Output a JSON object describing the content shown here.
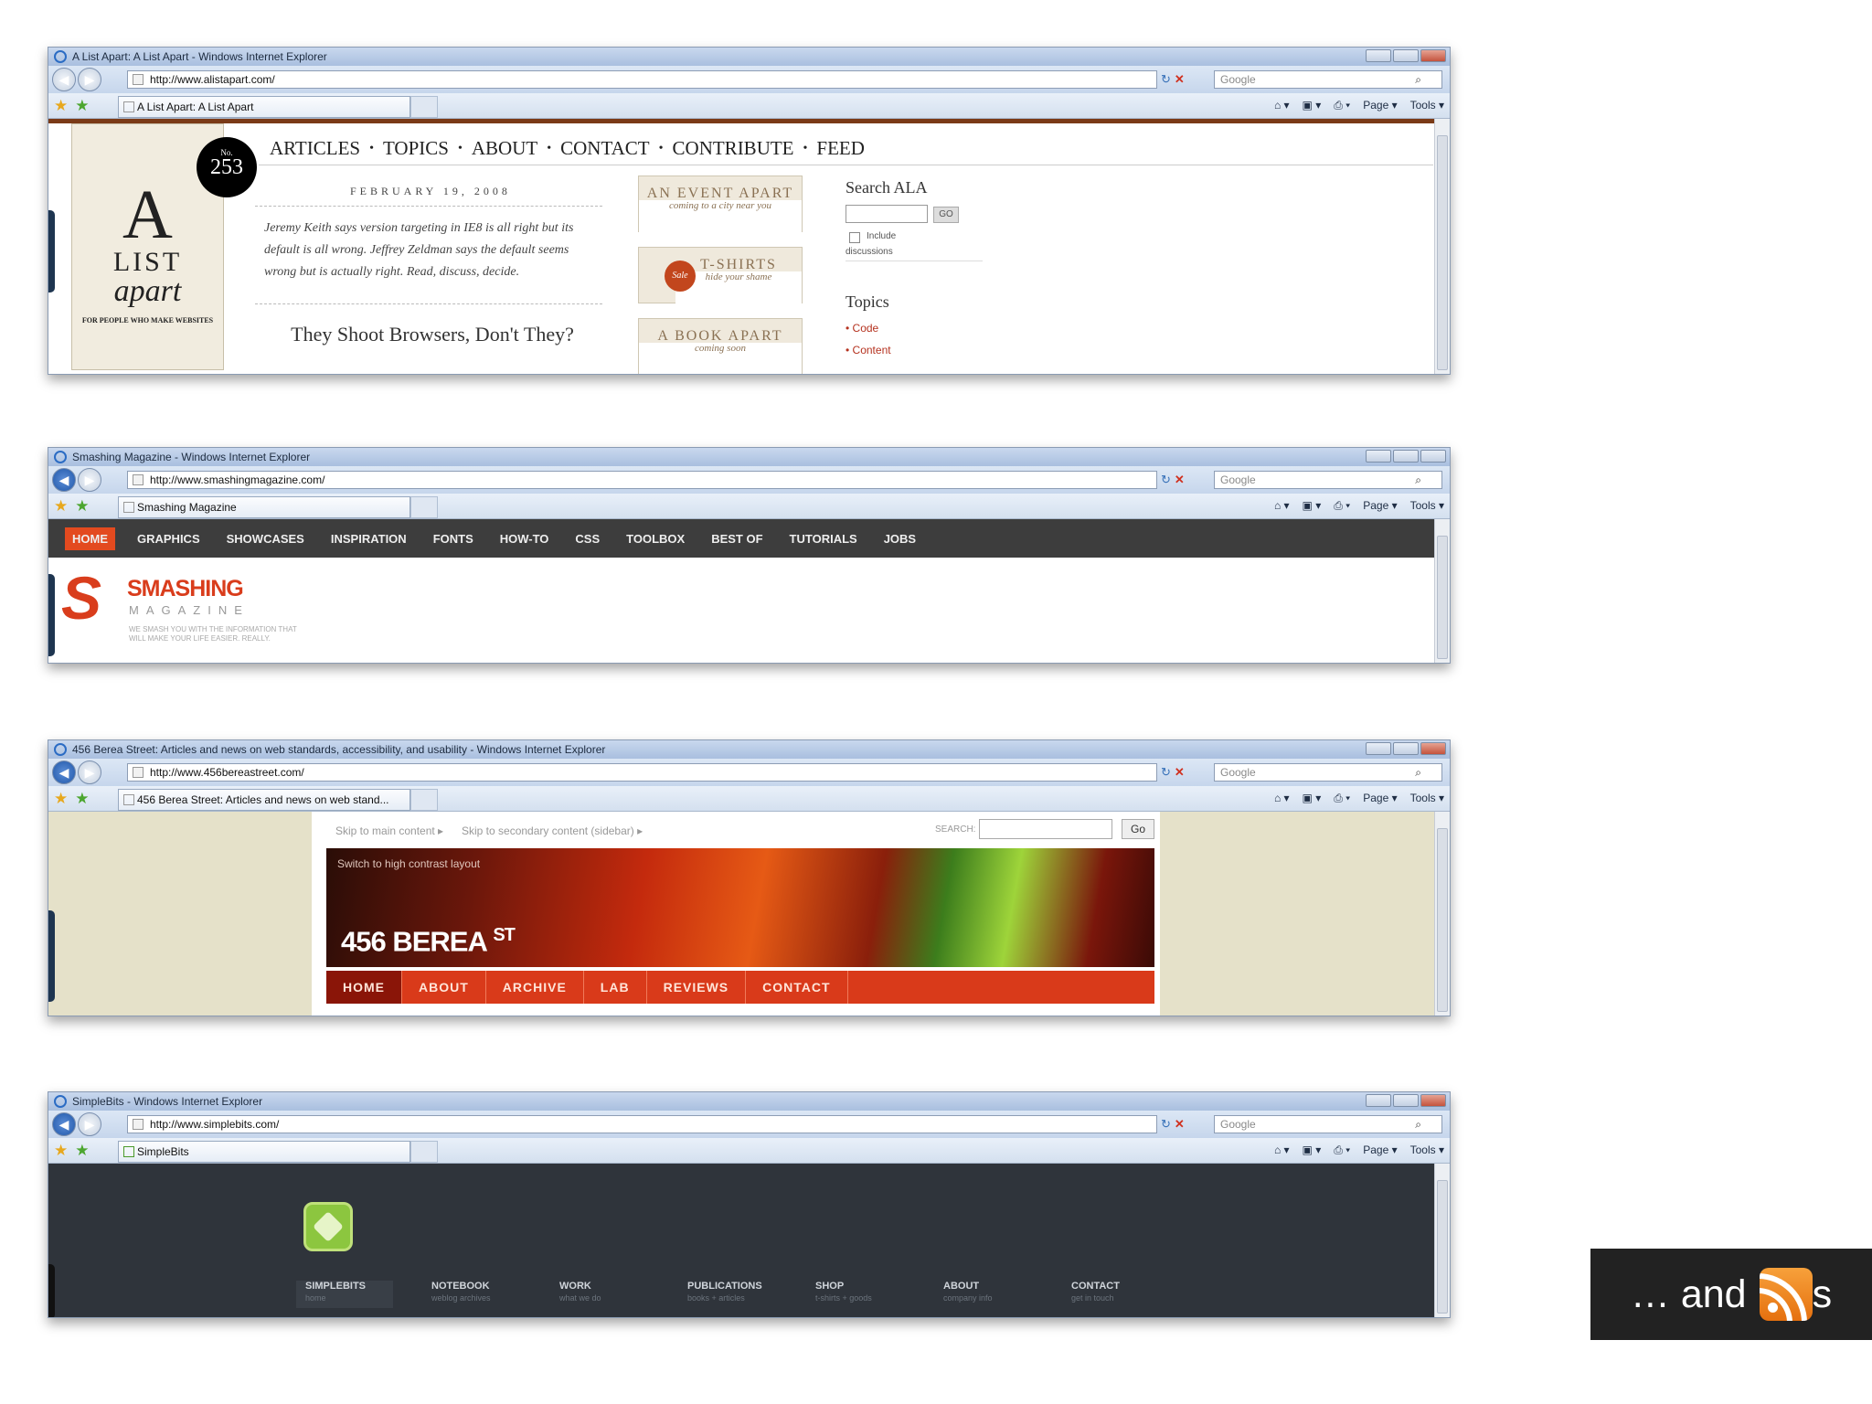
{
  "windows": [
    {
      "title": "A List Apart: A List Apart - Windows Internet Explorer",
      "url": "http://www.alistapart.com/",
      "search_placeholder": "Google",
      "tab": "A List Apart: A List Apart",
      "commands": [
        "Page ▾",
        "Tools ▾"
      ]
    },
    {
      "title": "Smashing Magazine - Windows Internet Explorer",
      "url": "http://www.smashingmagazine.com/",
      "search_placeholder": "Google",
      "tab": "Smashing Magazine",
      "commands": [
        "Page ▾",
        "Tools ▾"
      ]
    },
    {
      "title": "456 Berea Street: Articles and news on web standards, accessibility, and usability - Windows Internet Explorer",
      "url": "http://www.456bereastreet.com/",
      "search_placeholder": "Google",
      "tab": "456 Berea Street: Articles and news on web stand...",
      "commands": [
        "Page ▾",
        "Tools ▾"
      ]
    },
    {
      "title": "SimpleBits - Windows Internet Explorer",
      "url": "http://www.simplebits.com/",
      "search_placeholder": "Google",
      "tab": "SimpleBits",
      "commands": [
        "Page ▾",
        "Tools ▾"
      ]
    }
  ],
  "ala": {
    "issue_label": "No.",
    "issue_number": "253",
    "logo_a": "A",
    "logo_list": "LIST",
    "logo_apart": "apart",
    "logo_tag": "FOR PEOPLE WHO MAKE WEBSITES",
    "nav": [
      "ARTICLES",
      "TOPICS",
      "ABOUT",
      "CONTACT",
      "CONTRIBUTE",
      "FEED"
    ],
    "date": "FEBRUARY 19, 2008",
    "blurb": "Jeremy Keith says version targeting in IE8 is all right but its default is all wrong. Jeffrey Zeldman says the default seems wrong but is actually right. Read, discuss, decide.",
    "headline": "They Shoot Browsers, Don't They?",
    "promos": [
      {
        "big": "AN EVENT APART",
        "small": "coming to a city near you"
      },
      {
        "big": "T-SHIRTS",
        "small": "hide your shame",
        "badge": "Sale"
      },
      {
        "big": "A BOOK APART",
        "small": "coming soon"
      }
    ],
    "search_label": "Search ALA",
    "go": "GO",
    "include": "Include",
    "discussions": "discussions",
    "topics_label": "Topics",
    "topics": [
      "Code",
      "Content"
    ]
  },
  "smashing": {
    "nav": [
      "HOME",
      "GRAPHICS",
      "SHOWCASES",
      "INSPIRATION",
      "FONTS",
      "HOW-TO",
      "CSS",
      "TOOLBOX",
      "BEST OF",
      "TUTORIALS",
      "JOBS"
    ],
    "logo_s": "S",
    "name": "SMASHING",
    "magazine": "MAGAZINE",
    "tagline": "WE SMASH YOU WITH THE INFORMATION THAT WILL MAKE YOUR LIFE EASIER. REALLY."
  },
  "berea": {
    "skip1": "Skip to main content ▸",
    "skip2": "Skip to secondary content (sidebar) ▸",
    "search_label": "SEARCH:",
    "go": "Go",
    "high_contrast": "Switch to high contrast layout",
    "logo": "456 BEREA",
    "logo_sup": "ST",
    "menu": [
      "HOME",
      "ABOUT",
      "ARCHIVE",
      "LAB",
      "REVIEWS",
      "CONTACT"
    ]
  },
  "simplebits": {
    "nav": [
      {
        "label": "SIMPLEBITS",
        "sub": "home"
      },
      {
        "label": "NOTEBOOK",
        "sub": "weblog archives"
      },
      {
        "label": "WORK",
        "sub": "what we do"
      },
      {
        "label": "PUBLICATIONS",
        "sub": "books + articles"
      },
      {
        "label": "SHOP",
        "sub": "t-shirts + goods"
      },
      {
        "label": "ABOUT",
        "sub": "company info"
      },
      {
        "label": "CONTACT",
        "sub": "get in touch"
      }
    ]
  },
  "rss_text_pre": "… and",
  "rss_text_post": "s",
  "colors": {
    "ala_accent": "#7a3a17",
    "smashing_red": "#d93d1c",
    "berea_red": "#d93a1a",
    "simplebits_green": "#8cc63f",
    "rss_orange": "#f08a24"
  }
}
